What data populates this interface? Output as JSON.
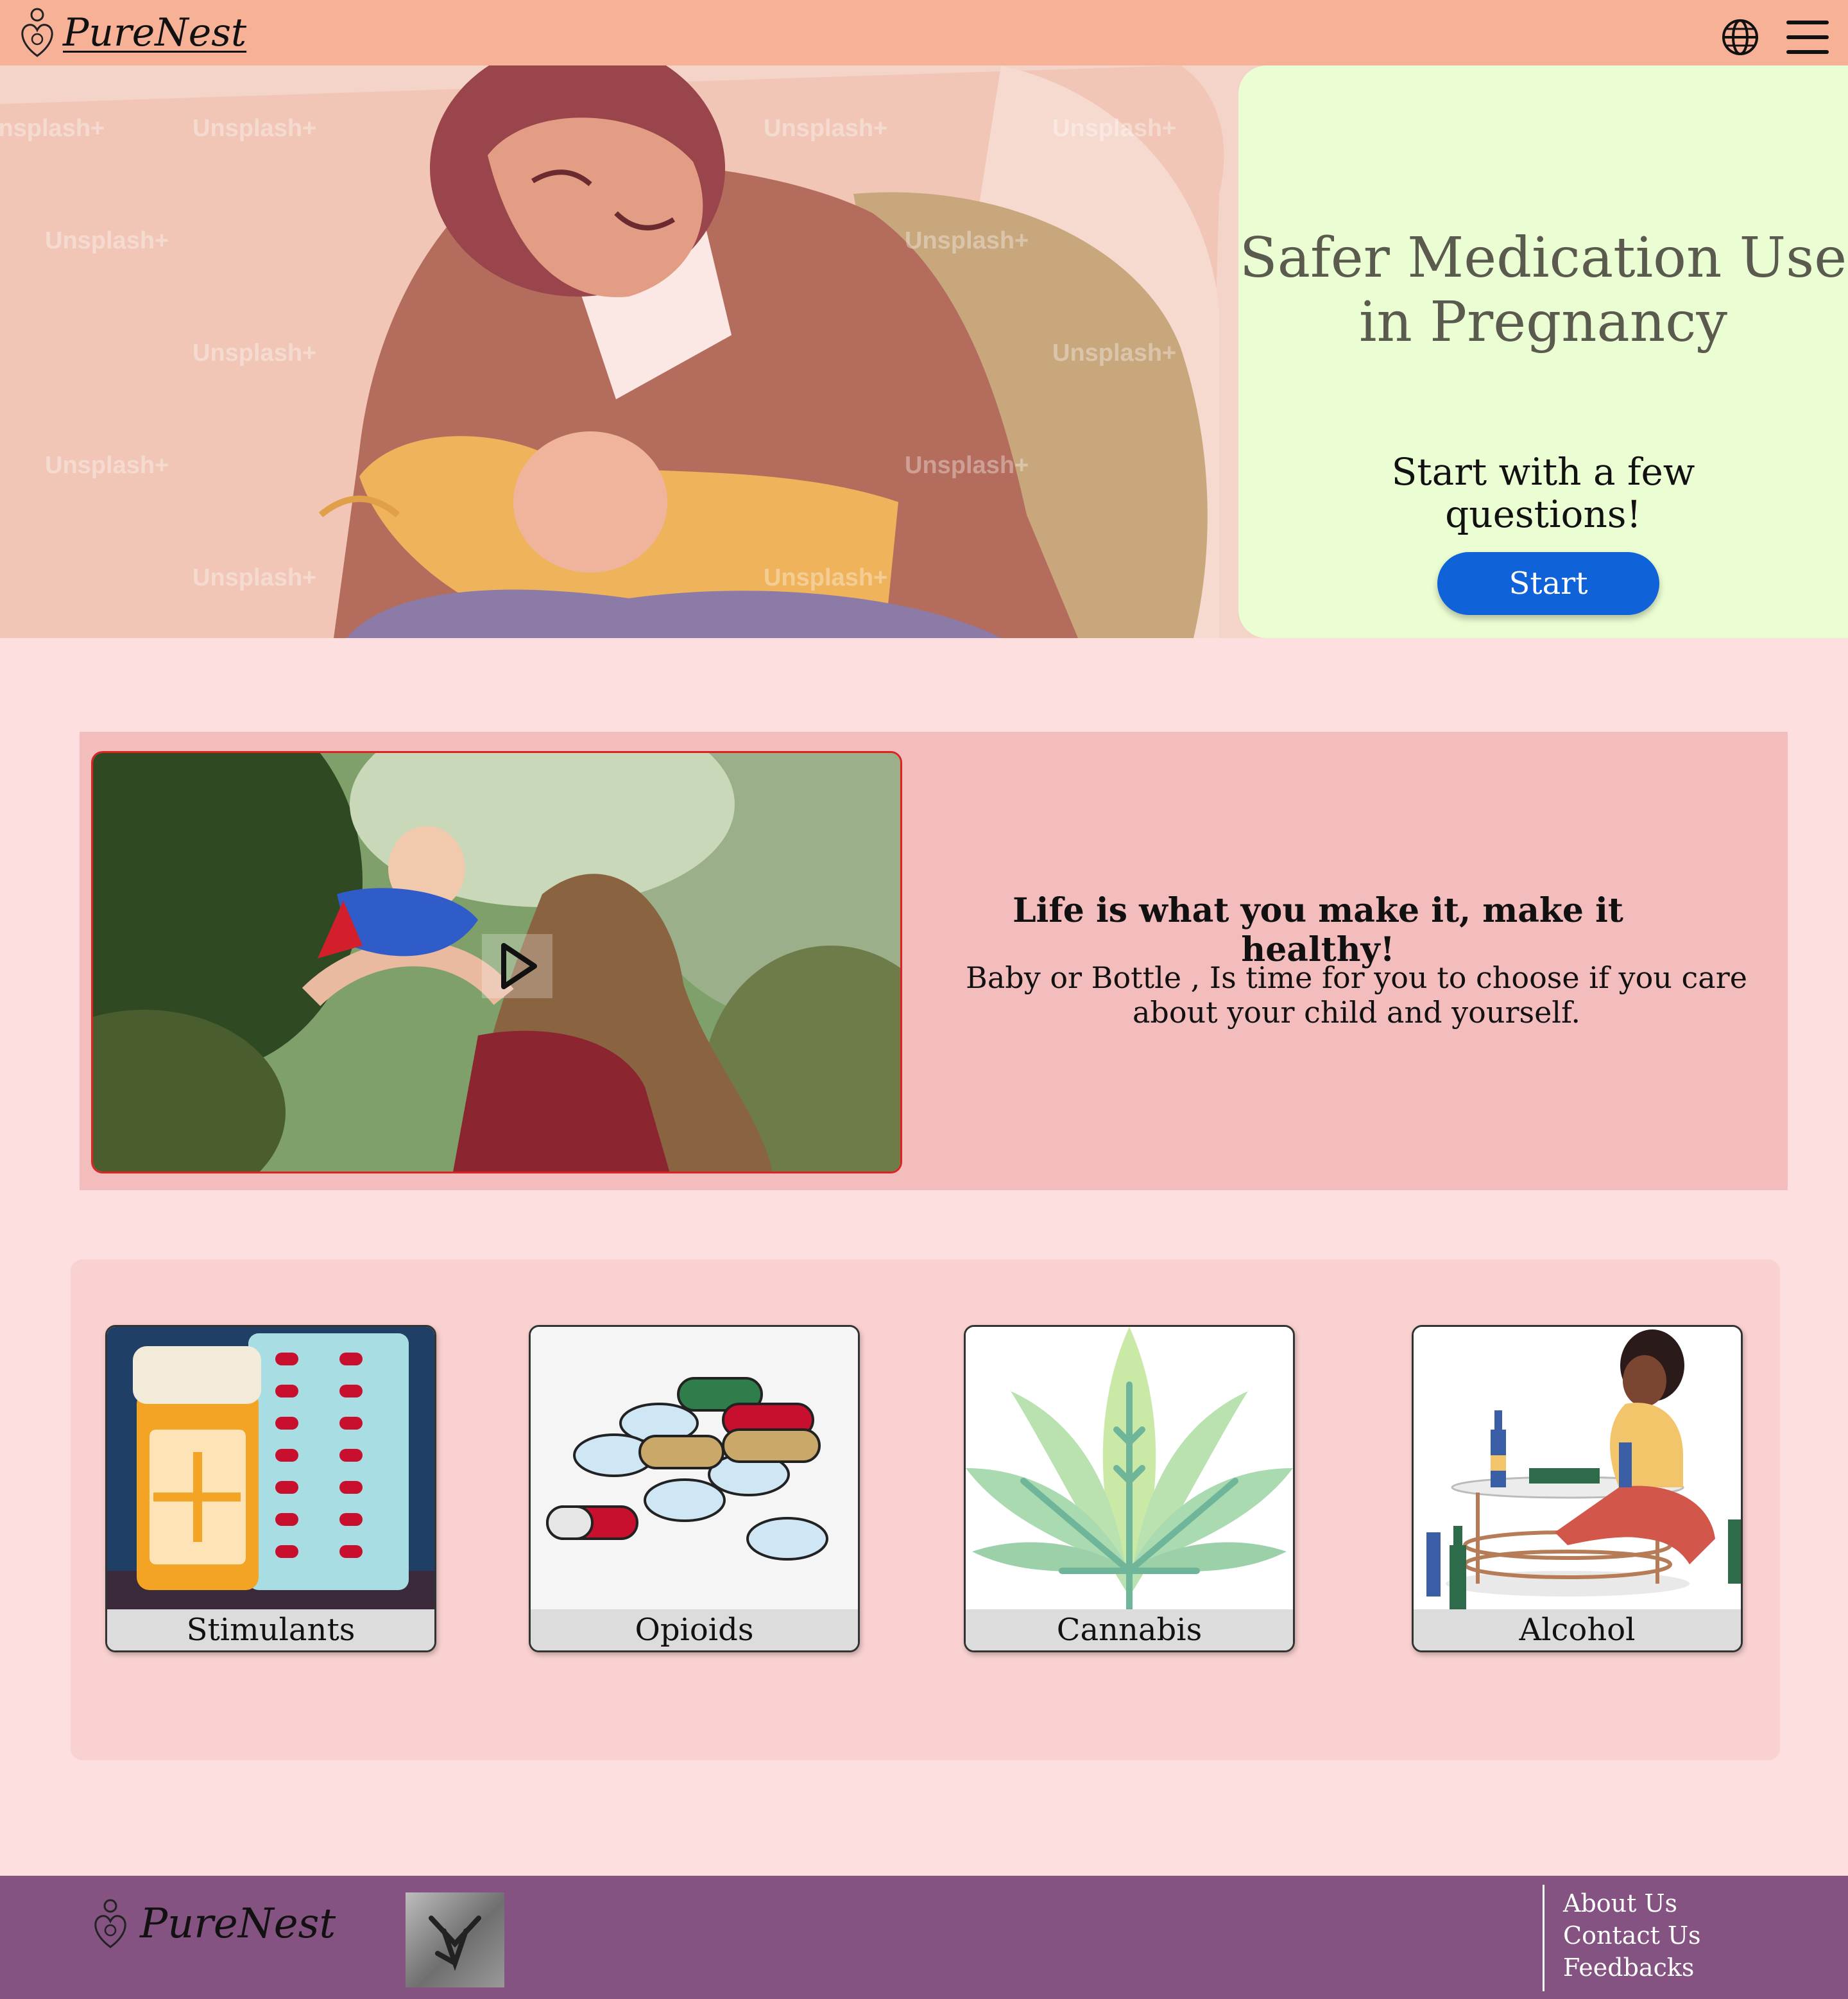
{
  "header": {
    "brand": "PureNest",
    "icons": [
      "globe-icon",
      "menu-icon"
    ]
  },
  "hero": {
    "watermark": "Unsplash+",
    "title": "Safer Medication Use in Pregnancy",
    "subtitle": "Start with a few questions!",
    "start_label": "Start"
  },
  "promo": {
    "heading": "Life is what you make it, make it healthy!",
    "body": "Baby or Bottle , Is time for you to choose if you care about your child and yourself.",
    "icons": [
      "play-icon"
    ]
  },
  "categories": [
    {
      "label": "Stimulants"
    },
    {
      "label": "Opioids"
    },
    {
      "label": "Cannabis"
    },
    {
      "label": "Alcohol"
    }
  ],
  "footer": {
    "brand": "PureNest",
    "links": [
      "About Us",
      "Contact Us",
      "Feedbacks"
    ]
  },
  "colors": {
    "header": "#f6b196",
    "hero_card": "#ebfdd2",
    "start_button": "#0f62d8",
    "promo": "#f4bdbd",
    "page": "#fddfe0",
    "footer": "#845381"
  }
}
